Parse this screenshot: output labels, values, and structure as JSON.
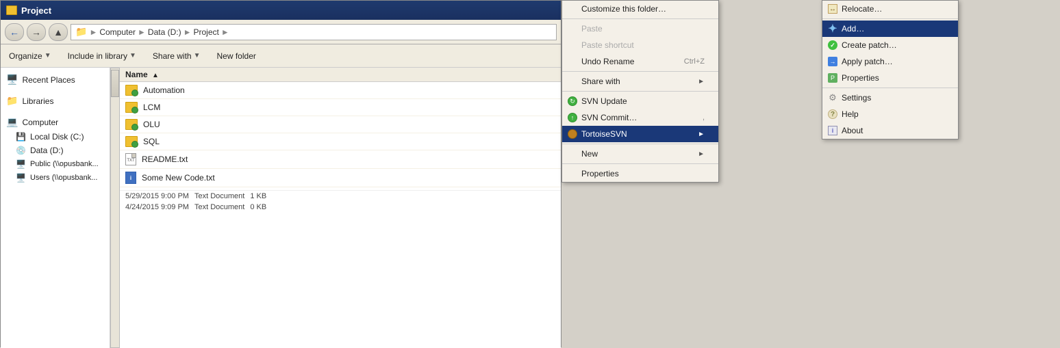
{
  "window": {
    "title": "Project",
    "address": {
      "parts": [
        "Computer",
        "Data (D:)",
        "Project"
      ]
    }
  },
  "toolbar": {
    "organize": "Organize",
    "include_in_library": "Include in library",
    "share_with": "Share with",
    "new_folder": "New folder"
  },
  "sidebar": {
    "items": [
      {
        "label": "Recent Places",
        "type": "recent"
      },
      {
        "label": "Libraries",
        "type": "library"
      },
      {
        "label": "Computer",
        "type": "computer"
      },
      {
        "label": "Local Disk (C:)",
        "type": "disk"
      },
      {
        "label": "Data (D:)",
        "type": "disk"
      },
      {
        "label": "Public (\\\\opusbank...",
        "type": "network"
      },
      {
        "label": "Users (\\\\opusbank...",
        "type": "network"
      }
    ]
  },
  "file_list": {
    "column_header": "Name",
    "items": [
      {
        "name": "Automation",
        "type": "folder",
        "svn": true
      },
      {
        "name": "LCM",
        "type": "folder",
        "svn": true
      },
      {
        "name": "OLU",
        "type": "folder",
        "svn": true
      },
      {
        "name": "SQL",
        "type": "folder",
        "svn": true
      },
      {
        "name": "README.txt",
        "type": "txt",
        "svn": false
      },
      {
        "name": "Some New Code.txt",
        "type": "txt_blue",
        "date": "4/24/2015 9:09 PM",
        "file_type": "Text Document",
        "size": "0 KB"
      }
    ],
    "readme_date": "5/29/2015 9:00 PM",
    "readme_type": "Text Document",
    "readme_size": "1 KB"
  },
  "context_menu": {
    "items": [
      {
        "label": "Customize this folder…",
        "disabled": false,
        "id": "customize"
      },
      {
        "label": "Paste",
        "disabled": true,
        "id": "paste"
      },
      {
        "label": "Paste shortcut",
        "disabled": true,
        "id": "paste-shortcut"
      },
      {
        "label": "Undo Rename",
        "shortcut": "Ctrl+Z",
        "disabled": false,
        "id": "undo-rename"
      },
      {
        "label": "Share with",
        "submenu": true,
        "id": "share-with"
      },
      {
        "label": "SVN Update",
        "svn": true,
        "id": "svn-update"
      },
      {
        "label": "SVN Commit…",
        "shortcut": ",",
        "svn": true,
        "id": "svn-commit"
      },
      {
        "label": "TortoiseSVN",
        "submenu": true,
        "highlighted": true,
        "id": "tortoise-svn"
      },
      {
        "label": "New",
        "submenu": true,
        "id": "new"
      },
      {
        "label": "Properties",
        "id": "properties"
      }
    ]
  },
  "submenu": {
    "items": [
      {
        "label": "Relocate…",
        "id": "relocate"
      },
      {
        "label": "Add…",
        "highlighted": true,
        "id": "add"
      },
      {
        "label": "Create patch…",
        "id": "create-patch"
      },
      {
        "label": "Apply patch…",
        "id": "apply-patch"
      },
      {
        "label": "Properties",
        "id": "svn-properties"
      },
      {
        "label": "Settings",
        "id": "settings"
      },
      {
        "label": "Help",
        "id": "help"
      },
      {
        "label": "About",
        "id": "about"
      }
    ]
  }
}
